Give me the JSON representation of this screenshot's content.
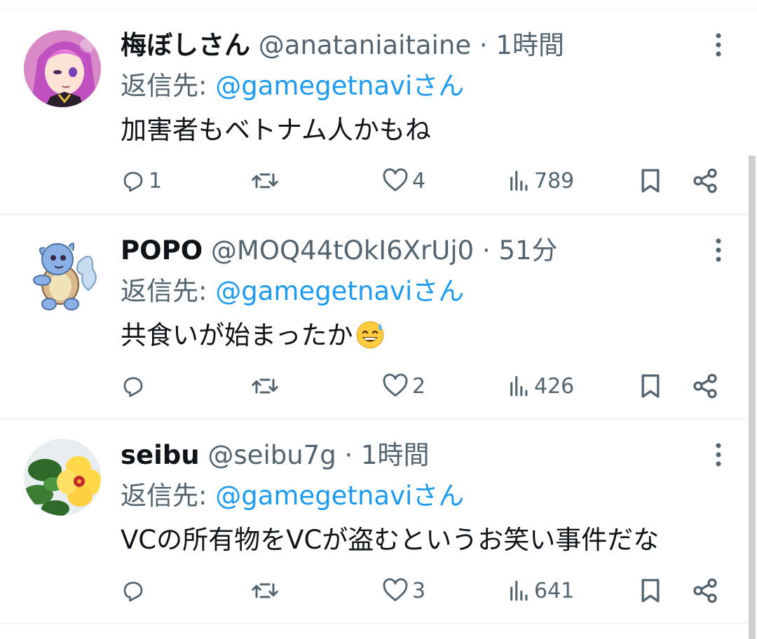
{
  "colors": {
    "text": "#0f1419",
    "secondary": "#536471",
    "link": "#1d9bf0",
    "divider": "#eff3f4"
  },
  "posts": [
    {
      "display_name": "梅ぼしさん",
      "handle": "@anataniaitaine",
      "separator": "·",
      "time": "1時間",
      "reply_prefix": "返信先:",
      "reply_to": "@gamegetnaviさん",
      "text": "加害者もベトナム人かもね",
      "replies": "1",
      "retweets": "",
      "likes": "4",
      "views": "789",
      "avatar": "anime-girl-avatar"
    },
    {
      "display_name": "POPO",
      "handle": "@MOQ44tOkI6XrUj0",
      "separator": "·",
      "time": "51分",
      "reply_prefix": "返信先:",
      "reply_to": "@gamegetnaviさん",
      "text": "共食いが始まったか",
      "text_emoji": "sweat-smile-emoji",
      "replies": "",
      "retweets": "",
      "likes": "2",
      "views": "426",
      "avatar": "blue-turtle-avatar"
    },
    {
      "display_name": "seibu",
      "handle": "@seibu7g",
      "separator": "·",
      "time": "1時間",
      "reply_prefix": "返信先:",
      "reply_to": "@gamegetnaviさん",
      "text": "VCの所有物をVCが盗むというお笑い事件だな",
      "replies": "",
      "retweets": "",
      "likes": "3",
      "views": "641",
      "avatar": "yellow-flower-avatar"
    }
  ]
}
